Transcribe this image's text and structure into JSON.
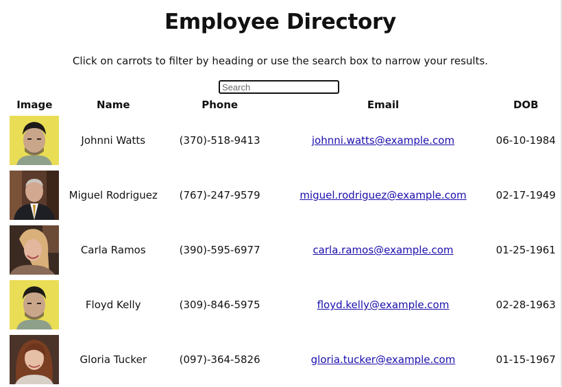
{
  "header": {
    "title": "Employee Directory",
    "subtitle": "Click on carrots to filter by heading or use the search box to narrow your results."
  },
  "search": {
    "placeholder": "Search",
    "value": ""
  },
  "table": {
    "columns": [
      "Image",
      "Name",
      "Phone",
      "Email",
      "DOB"
    ],
    "rows": [
      {
        "name": "Johnni Watts",
        "phone": "(370)-518-9413",
        "email": "johnni.watts@example.com",
        "dob": "06-10-1984",
        "photo": "man-yellow-background"
      },
      {
        "name": "Miguel Rodriguez",
        "phone": "(767)-247-9579",
        "email": "miguel.rodriguez@example.com",
        "dob": "02-17-1949",
        "photo": "man-in-suit"
      },
      {
        "name": "Carla Ramos",
        "phone": "(390)-595-6977",
        "email": "carla.ramos@example.com",
        "dob": "01-25-1961",
        "photo": "woman-blonde"
      },
      {
        "name": "Floyd Kelly",
        "phone": "(309)-846-5975",
        "email": "floyd.kelly@example.com",
        "dob": "02-28-1963",
        "photo": "man-yellow-background"
      },
      {
        "name": "Gloria Tucker",
        "phone": "(097)-364-5826",
        "email": "gloria.tucker@example.com",
        "dob": "01-15-1967",
        "photo": "woman-brunette"
      }
    ]
  },
  "colors": {
    "link": "#1a0dab",
    "text": "#111111"
  }
}
